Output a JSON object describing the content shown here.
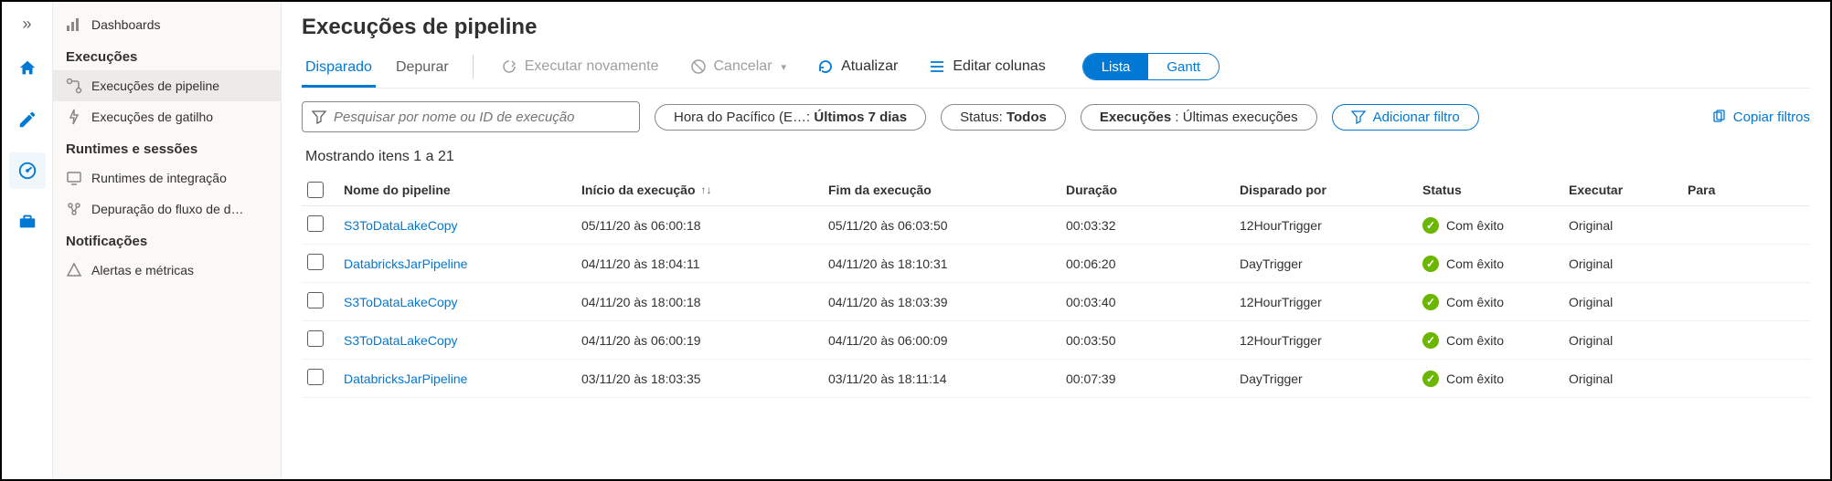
{
  "rail": {
    "items": [
      {
        "name": "home-icon",
        "color": "#0078d4"
      },
      {
        "name": "edit-icon",
        "color": "#0078d4"
      },
      {
        "name": "monitor-icon",
        "color": "#0078d4",
        "active": true
      },
      {
        "name": "toolbox-icon",
        "color": "#0078d4"
      }
    ]
  },
  "sidebar": {
    "top_item": {
      "label": "Dashboards"
    },
    "sections": [
      {
        "title": "Execuções",
        "items": [
          {
            "label": "Execuções de pipeline",
            "selected": true,
            "icon": "pipeline-icon"
          },
          {
            "label": "Execuções de gatilho",
            "icon": "trigger-icon"
          }
        ]
      },
      {
        "title": "Runtimes e sessões",
        "items": [
          {
            "label": "Runtimes de integração",
            "icon": "runtime-icon"
          },
          {
            "label": "Depuração do fluxo de d…",
            "icon": "debug-flow-icon"
          }
        ]
      },
      {
        "title": "Notificações",
        "items": [
          {
            "label": "Alertas e métricas",
            "icon": "alert-icon"
          }
        ]
      }
    ]
  },
  "page": {
    "title": "Execuções de pipeline",
    "tabs": [
      {
        "label": "Disparado",
        "active": true
      },
      {
        "label": "Depurar"
      }
    ],
    "toolbar": {
      "rerun": "Executar novamente",
      "cancel": "Cancelar",
      "refresh": "Atualizar",
      "edit_columns": "Editar colunas"
    },
    "view_toggle": {
      "list": "Lista",
      "gantt": "Gantt"
    },
    "filters": {
      "search_placeholder": "Pesquisar por nome ou ID de execução",
      "time_prefix": "Hora do Pacífico (E…: ",
      "time_value": "Últimos 7 dias",
      "status_prefix": "Status: ",
      "status_value": "Todos",
      "runs_prefix": "Execuções",
      "runs_value": " : Últimas execuções",
      "add_filter": "Adicionar filtro",
      "copy_filters": "Copiar filtros"
    },
    "showing": "Mostrando itens 1 a 21",
    "columns": {
      "name": "Nome do pipeline",
      "start": "Início da execução",
      "end": "Fim da execução",
      "duration": "Duração",
      "triggered_by": "Disparado por",
      "status": "Status",
      "execute": "Executar",
      "params": "Para"
    },
    "rows": [
      {
        "name": "S3ToDataLakeCopy",
        "start": "05/11/20 às 06:00:18",
        "end": "05/11/20 às 06:03:50",
        "duration": "00:03:32",
        "trigger": "12HourTrigger",
        "status": "Com êxito",
        "exec": "Original"
      },
      {
        "name": "DatabricksJarPipeline",
        "start": "04/11/20 às 18:04:11",
        "end": "04/11/20 às 18:10:31",
        "duration": "00:06:20",
        "trigger": "DayTrigger",
        "status": "Com êxito",
        "exec": "Original"
      },
      {
        "name": "S3ToDataLakeCopy",
        "start": "04/11/20 às 18:00:18",
        "end": "04/11/20 às 18:03:39",
        "duration": "00:03:40",
        "trigger": "12HourTrigger",
        "status": "Com êxito",
        "exec": "Original"
      },
      {
        "name": "S3ToDataLakeCopy",
        "start": "04/11/20 às 06:00:19",
        "end": "04/11/20 às 06:00:09",
        "duration": "00:03:50",
        "trigger": "12HourTrigger",
        "status": "Com êxito",
        "exec": "Original"
      },
      {
        "name": "DatabricksJarPipeline",
        "start": "03/11/20 às 18:03:35",
        "end": "03/11/20 às 18:11:14",
        "duration": "00:07:39",
        "trigger": "DayTrigger",
        "status": "Com êxito",
        "exec": "Original"
      }
    ]
  }
}
